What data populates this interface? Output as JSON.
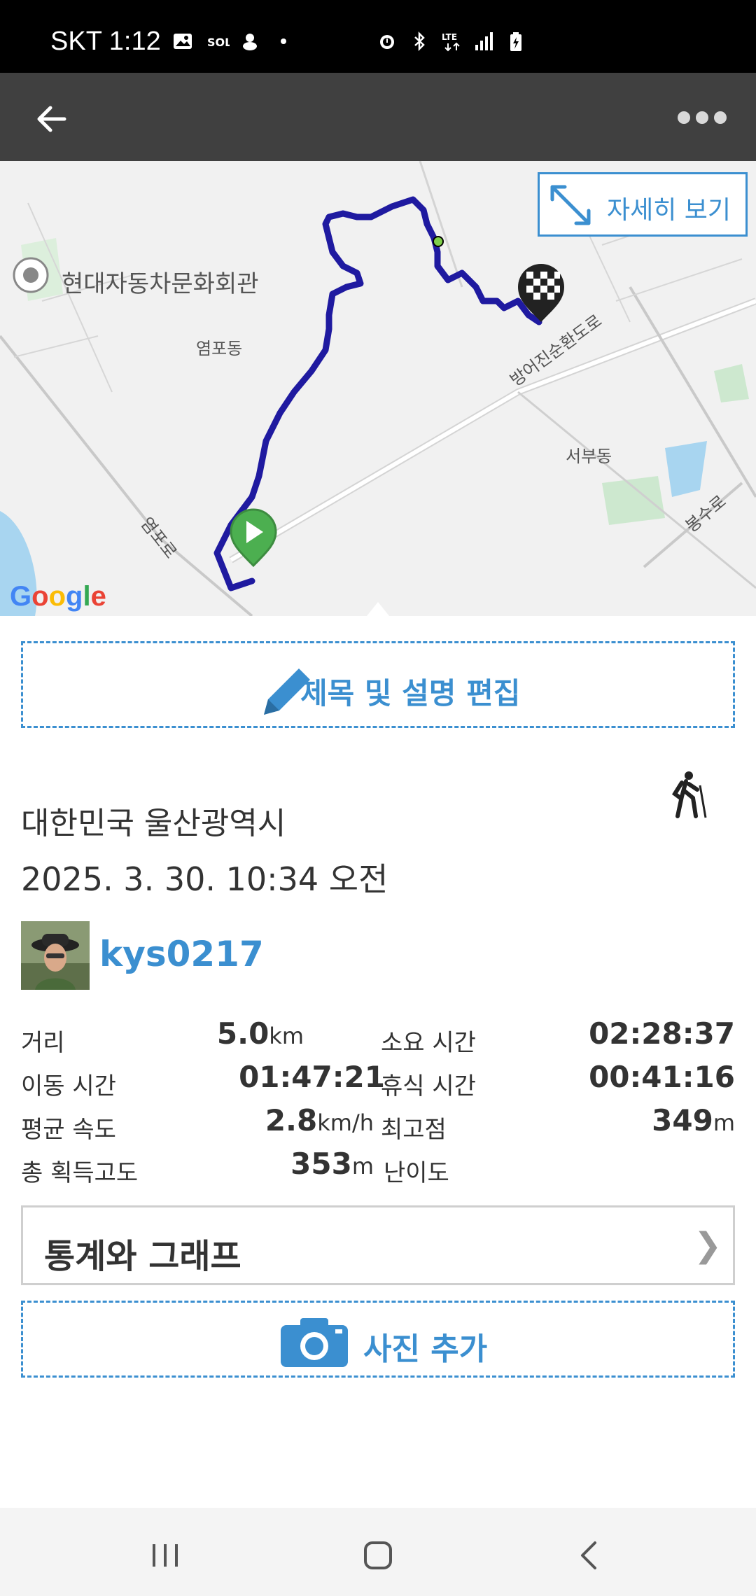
{
  "status_bar": {
    "time": "SKT 1:12",
    "left_icons": [
      "gallery-icon",
      "sol-bank-icon",
      "app-icon",
      "dot-icon"
    ],
    "right_icons": [
      "alarm-icon",
      "bluetooth-icon",
      "lte-icon",
      "signal-icon",
      "battery-charging-icon"
    ]
  },
  "app_bar": {
    "back_icon": "arrow-back-icon",
    "more_icon": "more-dots-icon"
  },
  "map": {
    "poi_label": "현대자동차문화회관",
    "labels": {
      "yeompo_dong": "염포동",
      "seobu_dong": "서부동",
      "yeompo_ro": "염포로",
      "bangeojin_ro": "방어진순환도로",
      "bongsu_ro": "봉수로"
    },
    "detail_button": "자세히 보기",
    "google": "Google"
  },
  "edit_button": "제목 및 설명 편집",
  "location": "대한민국 울산광역시",
  "datetime": "2025. 3. 30. 10:34 오전",
  "user": {
    "name": "kys0217"
  },
  "stats": {
    "distance_label": "거리",
    "distance_value": "5.0",
    "distance_unit": "km",
    "duration_label": "소요 시간",
    "duration_value": "02:28:37",
    "moving_label": "이동 시간",
    "moving_value": "01:47:21",
    "rest_label": "휴식 시간",
    "rest_value": "00:41:16",
    "avg_speed_label": "평균 속도",
    "avg_speed_value": "2.8",
    "avg_speed_unit": "km/h",
    "max_elev_label": "최고점",
    "max_elev_value": "349",
    "max_elev_unit": "m",
    "gain_label": "총 획득고도",
    "gain_value": "353",
    "gain_unit": "m",
    "difficulty_label": "난이도"
  },
  "graph_button": "통계와 그래프",
  "graph_chevron": "❯",
  "photo_button": "사진 추가",
  "colors": {
    "accent": "#3b8fd0",
    "route": "#1f1aa0",
    "appbar": "#404040"
  }
}
